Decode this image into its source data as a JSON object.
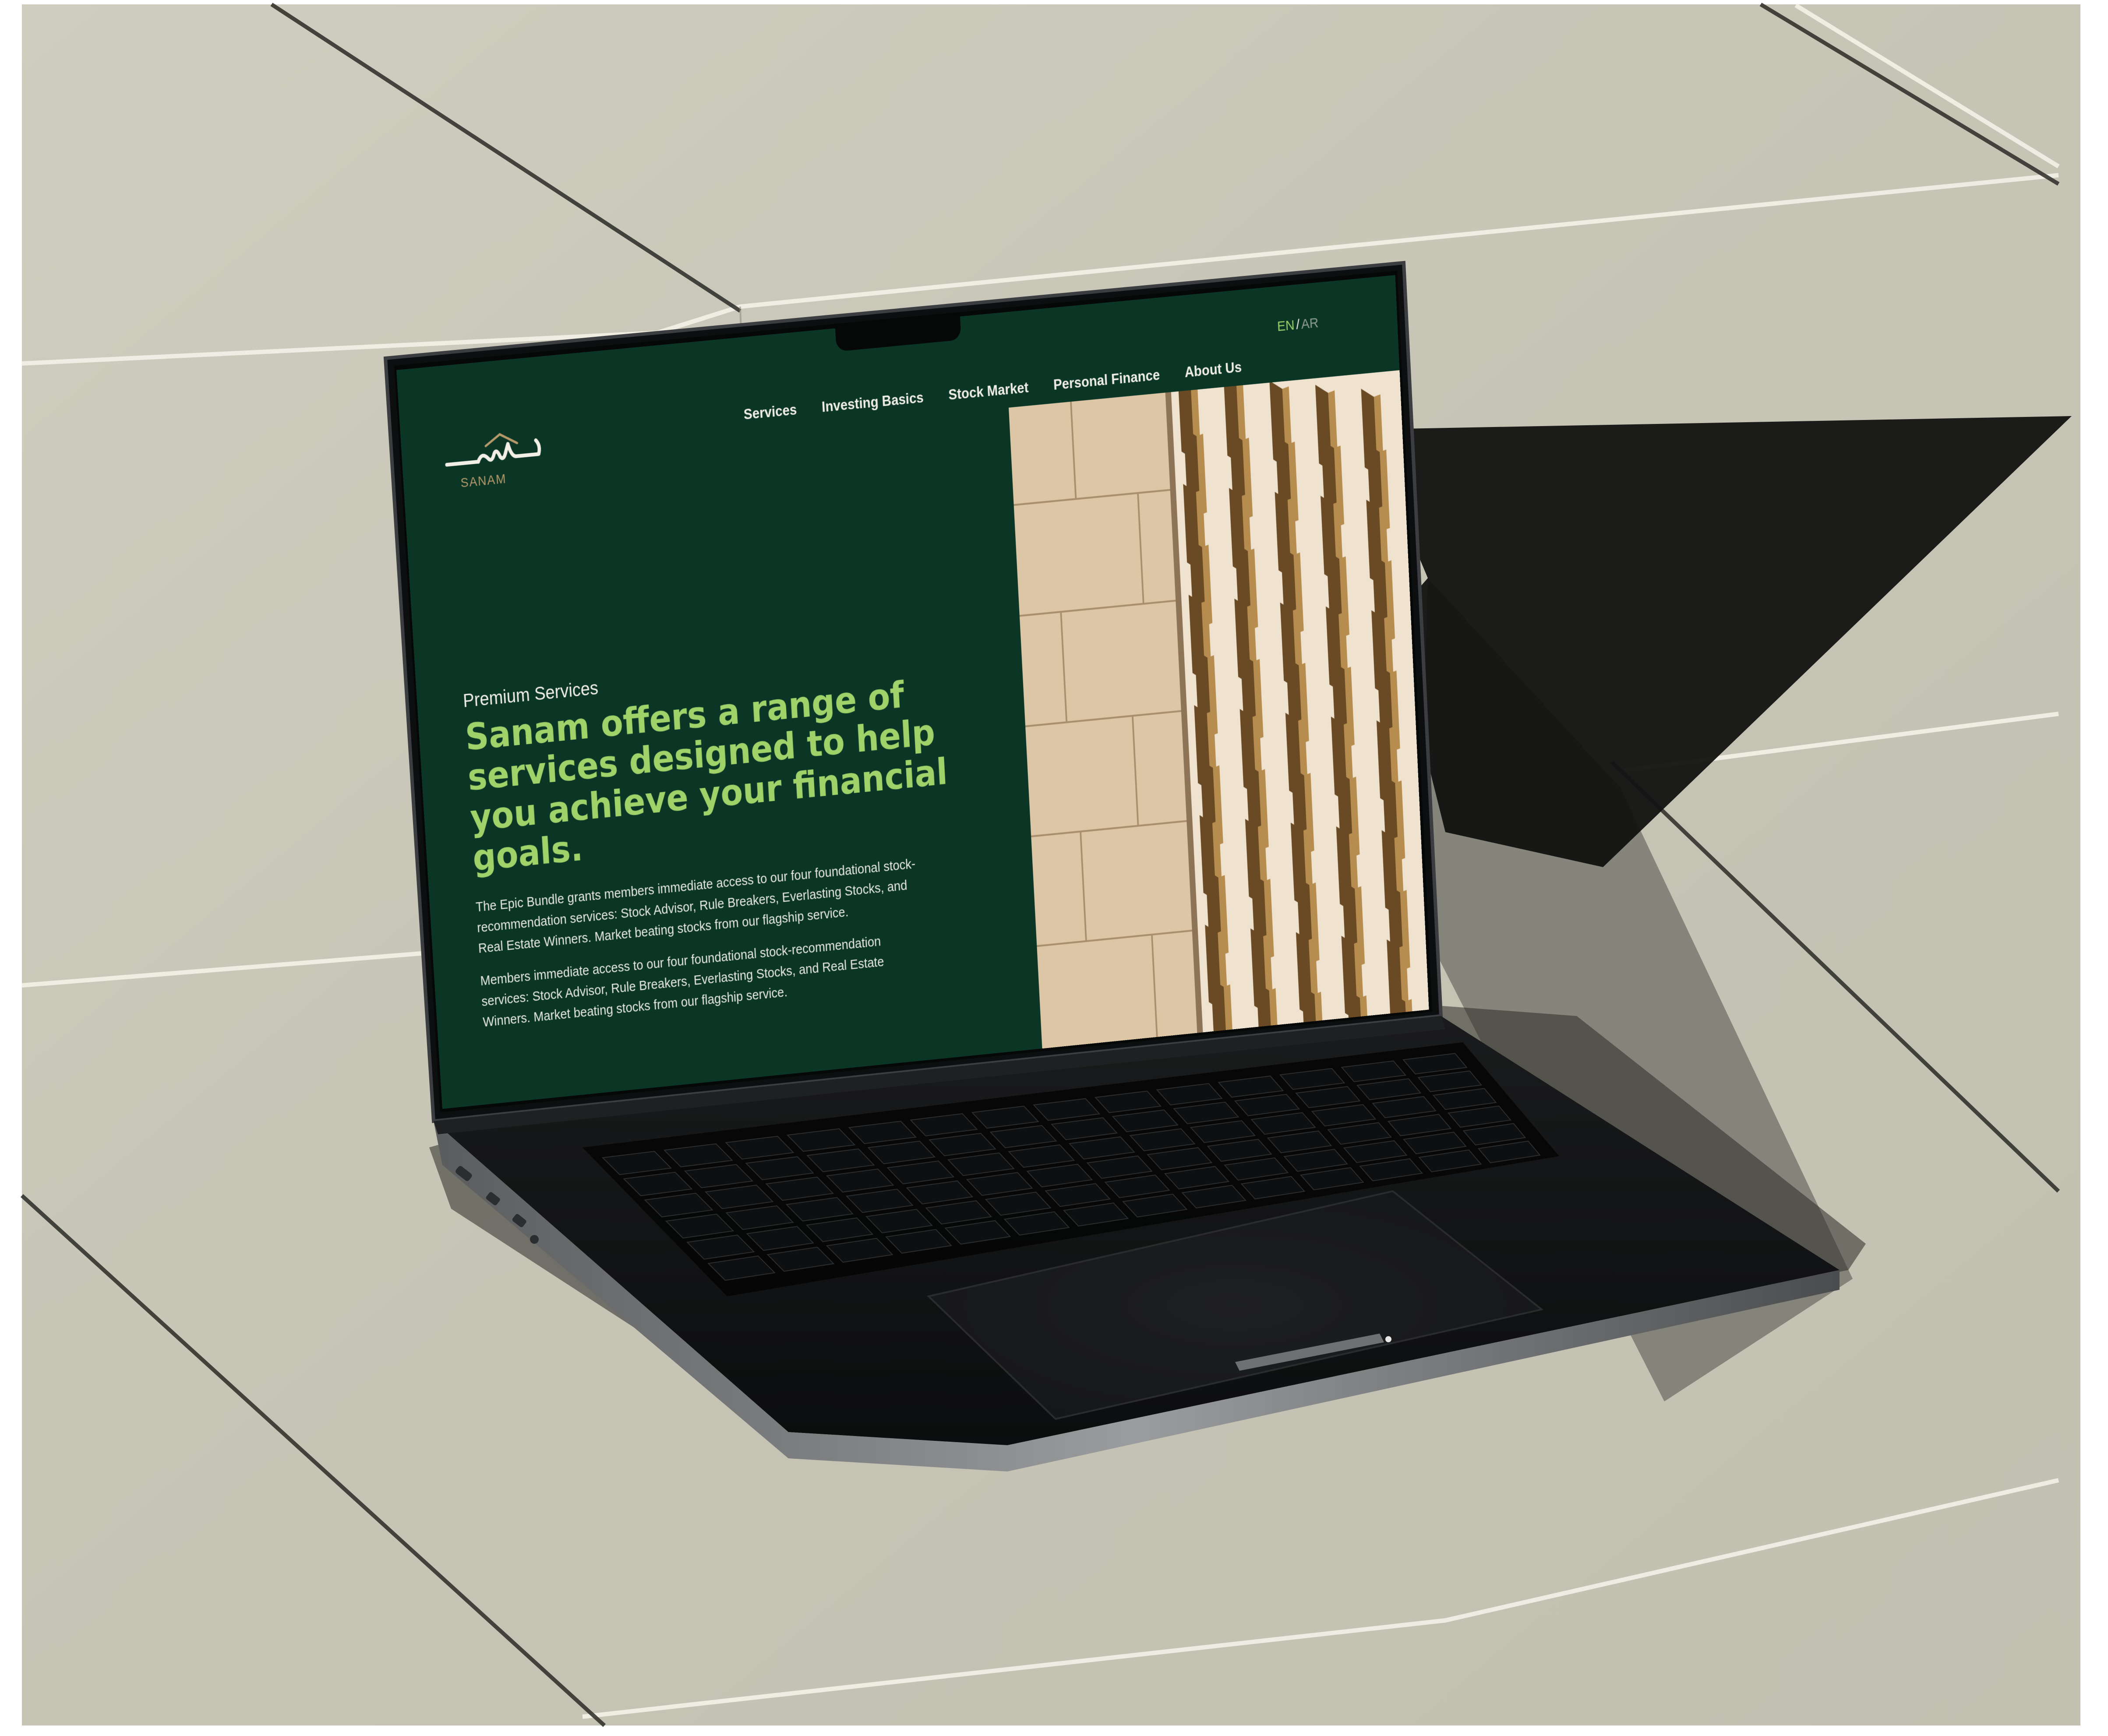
{
  "brand": {
    "name": "SANAM",
    "logo_arabic": "سنام"
  },
  "nav": {
    "items": [
      {
        "label": "Services"
      },
      {
        "label": "Investing Basics"
      },
      {
        "label": "Stock Market"
      },
      {
        "label": "Personal Finance"
      },
      {
        "label": "About Us"
      }
    ]
  },
  "language": {
    "active": "EN",
    "separator": "/",
    "inactive": "AR"
  },
  "hero": {
    "eyebrow": "Premium Services",
    "headline": "Sanam offers a range of services designed to help you achieve your financial goals.",
    "paragraphs": [
      "The Epic Bundle grants members immediate access to our four foundational stock-recommendation services: Stock Advisor, Rule Breakers, Everlasting Stocks, and Real Estate Winners. Market beating stocks from our flagship service.",
      "Members immediate access to our four foundational stock-recommendation services: Stock Advisor, Rule Breakers, Everlasting Stocks, and Real Estate Winners. Market beating stocks from our flagship service."
    ],
    "image_icon": "building-facade-image"
  },
  "colors": {
    "page_bg": "#0b3525",
    "accent_green": "#9fd36a",
    "logo_gold": "#b69a6a",
    "ground": "#c9c7b8",
    "laptop_body": "#111213"
  }
}
